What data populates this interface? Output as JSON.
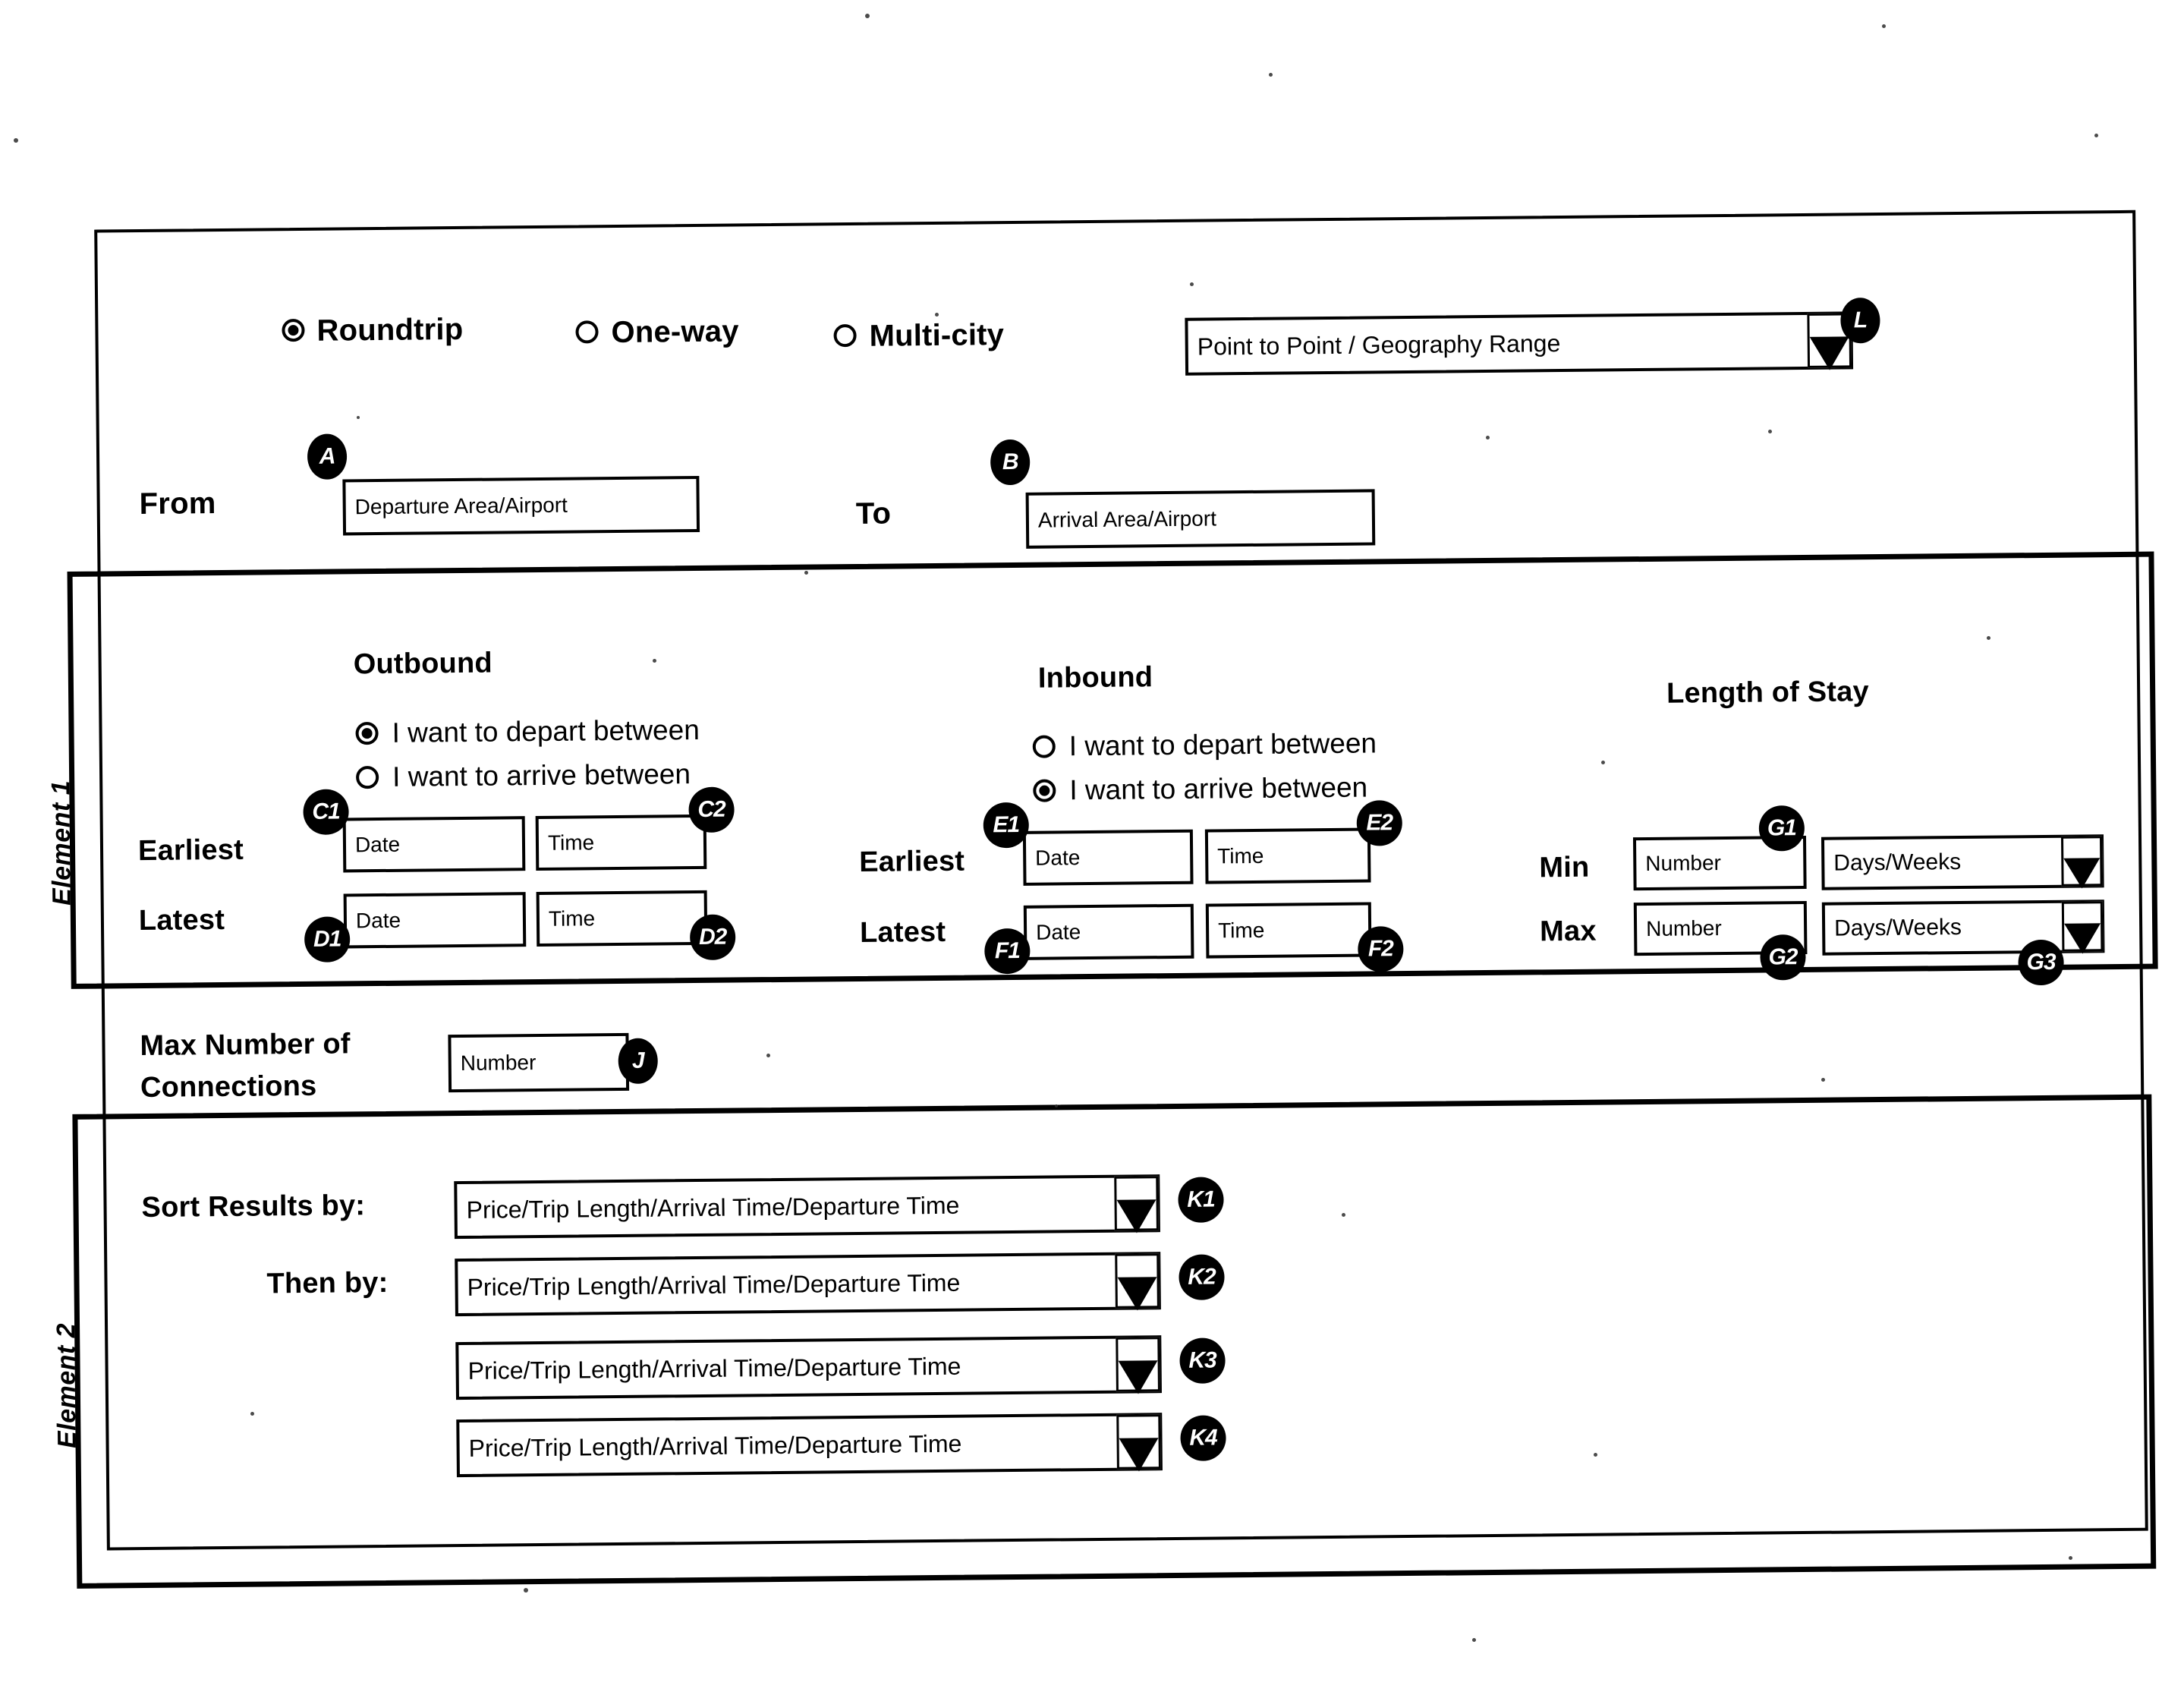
{
  "diagram": {
    "side_labels": {
      "element1": "Element 1",
      "element2": "Element 2"
    },
    "trip_type": {
      "options": [
        {
          "label": "Roundtrip",
          "selected": true
        },
        {
          "label": "One-way",
          "selected": false
        },
        {
          "label": "Multi-city",
          "selected": false
        }
      ]
    },
    "search_mode": {
      "value": "Point to Point / Geography Range",
      "marker": "L"
    },
    "route": {
      "from_label": "From",
      "from_value": "Departure Area/Airport",
      "from_marker": "A",
      "to_label": "To",
      "to_value": "Arrival Area/Airport",
      "to_marker": "B"
    },
    "outbound": {
      "title": "Outbound",
      "options": [
        {
          "label": "I want to depart between",
          "selected": true
        },
        {
          "label": "I want to arrive between",
          "selected": false
        }
      ],
      "rows": [
        {
          "label": "Earliest",
          "date_value": "Date",
          "date_marker": "C1",
          "time_value": "Time",
          "time_marker": "C2"
        },
        {
          "label": "Latest",
          "date_value": "Date",
          "date_marker": "D1",
          "time_value": "Time",
          "time_marker": "D2"
        }
      ]
    },
    "inbound": {
      "title": "Inbound",
      "options": [
        {
          "label": "I want to depart between",
          "selected": false
        },
        {
          "label": "I want to arrive between",
          "selected": true
        }
      ],
      "rows": [
        {
          "label": "Earliest",
          "date_value": "Date",
          "date_marker": "E1",
          "time_value": "Time",
          "time_marker": "E2"
        },
        {
          "label": "Latest",
          "date_value": "Date",
          "date_marker": "F1",
          "time_value": "Time",
          "time_marker": "F2"
        }
      ]
    },
    "length_of_stay": {
      "title": "Length of Stay",
      "rows": [
        {
          "label": "Min",
          "number_value": "Number",
          "number_marker": "G1",
          "unit_value": "Days/Weeks",
          "unit_marker": ""
        },
        {
          "label": "Max",
          "number_value": "Number",
          "number_marker": "G2",
          "unit_value": "Days/Weeks",
          "unit_marker": "G3"
        }
      ]
    },
    "connections": {
      "label_line1": "Max Number of",
      "label_line2": "Connections",
      "value": "Number",
      "marker": "J"
    },
    "sort": {
      "primary_label": "Sort Results by:",
      "secondary_label": "Then by:",
      "rows": [
        {
          "value": "Price/Trip Length/Arrival Time/Departure Time",
          "marker": "K1"
        },
        {
          "value": "Price/Trip Length/Arrival Time/Departure Time",
          "marker": "K2"
        },
        {
          "value": "Price/Trip Length/Arrival Time/Departure Time",
          "marker": "K3"
        },
        {
          "value": "Price/Trip Length/Arrival Time/Departure Time",
          "marker": "K4"
        }
      ]
    }
  }
}
